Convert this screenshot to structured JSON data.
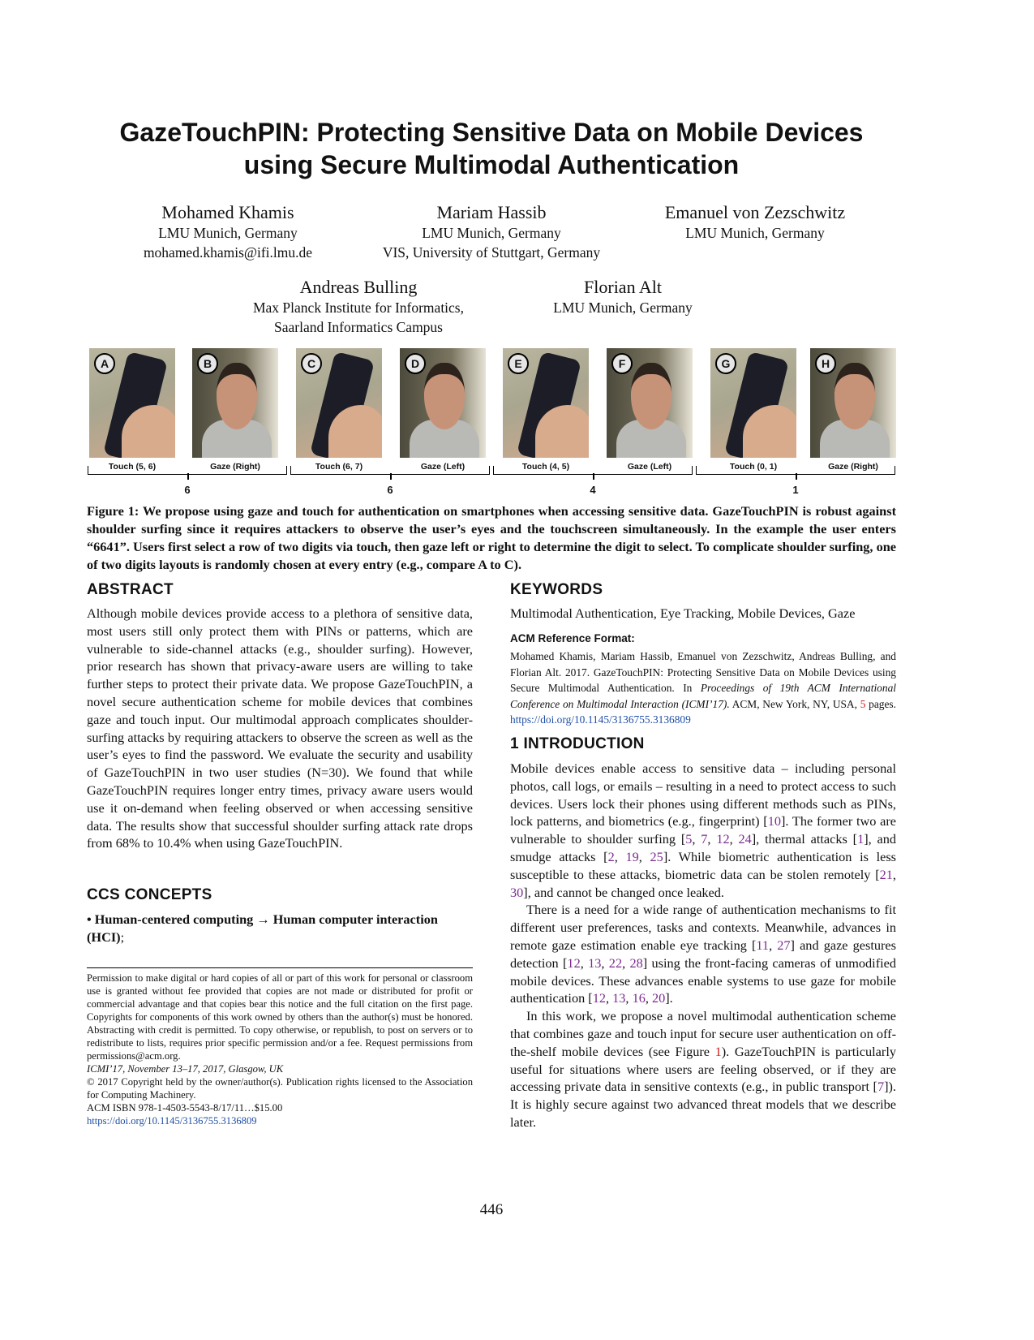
{
  "title": [
    "GazeTouchPIN: Protecting Sensitive Data on Mobile Devices",
    "using Secure Multimodal Authentication"
  ],
  "authors": [
    {
      "name": "Mohamed Khamis",
      "affil": [
        "LMU Munich, Germany",
        "mohamed.khamis@ifi.lmu.de"
      ]
    },
    {
      "name": "Mariam Hassib",
      "affil": [
        "LMU Munich, Germany",
        "VIS, University of Stuttgart, Germany"
      ]
    },
    {
      "name": "Emanuel von Zezschwitz",
      "affil": [
        "LMU Munich, Germany"
      ]
    },
    {
      "name": "Andreas Bulling",
      "affil": [
        "Max Planck Institute for Informatics,",
        "Saarland Informatics Campus"
      ]
    },
    {
      "name": "Florian Alt",
      "affil": [
        "LMU Munich, Germany"
      ]
    }
  ],
  "figure": {
    "panels": [
      {
        "letter": "A",
        "label": "Touch (5, 6)",
        "kind": "touch"
      },
      {
        "letter": "B",
        "label": "Gaze (Right)",
        "kind": "gaze"
      },
      {
        "letter": "C",
        "label": "Touch (6, 7)",
        "kind": "touch"
      },
      {
        "letter": "D",
        "label": "Gaze (Left)",
        "kind": "gaze"
      },
      {
        "letter": "E",
        "label": "Touch (4, 5)",
        "kind": "touch"
      },
      {
        "letter": "F",
        "label": "Gaze (Left)",
        "kind": "gaze"
      },
      {
        "letter": "G",
        "label": "Touch (0, 1)",
        "kind": "touch"
      },
      {
        "letter": "H",
        "label": "Gaze (Right)",
        "kind": "gaze"
      }
    ],
    "digits": [
      "6",
      "6",
      "4",
      "1"
    ],
    "caption": "Figure 1: We propose using gaze and touch for authentication on smartphones when accessing sensitive data. GazeTouchPIN is robust against shoulder surfing since it requires attackers to observe the user’s eyes and the touchscreen simultaneously. In the example the user enters “6641”. Users first select a row of two digits via touch, then gaze left or right to determine the digit to select. To complicate shoulder surfing, one of two digits layouts is randomly chosen at every entry (e.g., compare A to C)."
  },
  "abstract": {
    "heading": "ABSTRACT",
    "text": "Although mobile devices provide access to a plethora of sensitive data, most users still only protect them with PINs or patterns, which are vulnerable to side-channel attacks (e.g., shoulder surfing). However, prior research has shown that privacy-aware users are willing to take further steps to protect their private data. We propose GazeTouchPIN, a novel secure authentication scheme for mobile devices that combines gaze and touch input. Our multimodal approach complicates shoulder-surfing attacks by requiring attackers to observe the screen as well as the user’s eyes to find the password. We evaluate the security and usability of GazeTouchPIN in two user studies (N=30). We found that while GazeTouchPIN requires longer entry times, privacy aware users would use it on-demand when feeling observed or when accessing sensitive data. The results show that successful shoulder surfing attack rate drops from 68% to 10.4% when using GazeTouchPIN."
  },
  "ccs": {
    "heading": "CCS CONCEPTS",
    "bold": "• Human-centered computing → Human computer interaction (HCI)",
    "tail": ";"
  },
  "footnote": {
    "permission": "Permission to make digital or hard copies of all or part of this work for personal or classroom use is granted without fee provided that copies are not made or distributed for profit or commercial advantage and that copies bear this notice and the full citation on the first page. Copyrights for components of this work owned by others than the author(s) must be honored. Abstracting with credit is permitted. To copy otherwise, or republish, to post on servers or to redistribute to lists, requires prior specific permission and/or a fee. Request permissions from permissions@acm.org.",
    "venue": "ICMI’17, November 13–17, 2017, Glasgow, UK",
    "copyright": "© 2017 Copyright held by the owner/author(s). Publication rights licensed to the Association for Computing Machinery.",
    "isbn": "ACM ISBN 978-1-4503-5543-8/17/11…$15.00",
    "doi": "https://doi.org/10.1145/3136755.3136809"
  },
  "keywords": {
    "heading": "KEYWORDS",
    "text": "Multimodal Authentication, Eye Tracking, Mobile Devices, Gaze"
  },
  "acm_ref": {
    "heading": "ACM Reference Format:",
    "segments": [
      [
        "Mohamed Khamis, Mariam Hassib, Emanuel von Zezschwitz, Andreas Bulling, and Florian Alt. 2017. GazeTouchPIN: Protecting Sensitive Data on Mobile Devices using Secure Multimodal Authentication. In ",
        "t"
      ],
      [
        "Proceedings of 19th ACM International Conference on Multimodal Interaction (ICMI’17).",
        "i"
      ],
      [
        " ACM, New York, NY, USA, ",
        "t"
      ],
      [
        "5",
        "r"
      ],
      [
        " pages. ",
        "t"
      ],
      [
        "https://doi.org/10.1145/3136755.3136809",
        "l"
      ]
    ]
  },
  "intro": {
    "heading": "1   INTRODUCTION",
    "paragraphs": [
      [
        [
          "Mobile devices enable access to sensitive data – including personal photos, call logs, or emails – resulting in a need to protect access to such devices. Users lock their phones using different methods such as PINs, lock patterns, and biometrics (e.g., fingerprint) [",
          "t"
        ],
        [
          "10",
          "c"
        ],
        [
          "]. The former two are vulnerable to shoulder surfing [",
          "t"
        ],
        [
          "5",
          "c"
        ],
        [
          ", ",
          "t"
        ],
        [
          "7",
          "c"
        ],
        [
          ", ",
          "t"
        ],
        [
          "12",
          "c"
        ],
        [
          ", ",
          "t"
        ],
        [
          "24",
          "c"
        ],
        [
          "], thermal attacks [",
          "t"
        ],
        [
          "1",
          "c"
        ],
        [
          "], and smudge attacks [",
          "t"
        ],
        [
          "2",
          "c"
        ],
        [
          ", ",
          "t"
        ],
        [
          "19",
          "c"
        ],
        [
          ", ",
          "t"
        ],
        [
          "25",
          "c"
        ],
        [
          "]. While biometric authentication is less susceptible to these attacks, biometric data can be stolen remotely [",
          "t"
        ],
        [
          "21",
          "c"
        ],
        [
          ", ",
          "t"
        ],
        [
          "30",
          "c"
        ],
        [
          "], and cannot be changed once leaked.",
          "t"
        ]
      ],
      [
        [
          "There is a need for a wide range of authentication mechanisms to fit different user preferences, tasks and contexts. Meanwhile, advances in remote gaze estimation enable eye tracking [",
          "t"
        ],
        [
          "11",
          "c"
        ],
        [
          ", ",
          "t"
        ],
        [
          "27",
          "c"
        ],
        [
          "] and gaze gestures detection [",
          "t"
        ],
        [
          "12",
          "c"
        ],
        [
          ", ",
          "t"
        ],
        [
          "13",
          "c"
        ],
        [
          ", ",
          "t"
        ],
        [
          "22",
          "c"
        ],
        [
          ", ",
          "t"
        ],
        [
          "28",
          "c"
        ],
        [
          "] using the front-facing cameras of unmodified mobile devices. These advances enable systems to use gaze for mobile authentication [",
          "t"
        ],
        [
          "12",
          "c"
        ],
        [
          ", ",
          "t"
        ],
        [
          "13",
          "c"
        ],
        [
          ", ",
          "t"
        ],
        [
          "16",
          "c"
        ],
        [
          ", ",
          "t"
        ],
        [
          "20",
          "c"
        ],
        [
          "].",
          "t"
        ]
      ],
      [
        [
          "In this work, we propose a novel multimodal authentication scheme that combines gaze and touch input for secure user authentication on off-the-shelf mobile devices (see Figure ",
          "t"
        ],
        [
          "1",
          "r"
        ],
        [
          "). GazeTouchPIN is particularly useful for situations where users are feeling observed, or if they are accessing private data in sensitive contexts (e.g., in public transport [",
          "t"
        ],
        [
          "7",
          "c"
        ],
        [
          "]). It is highly secure against two advanced threat models that we describe later.",
          "t"
        ]
      ]
    ]
  },
  "page_number": "446"
}
